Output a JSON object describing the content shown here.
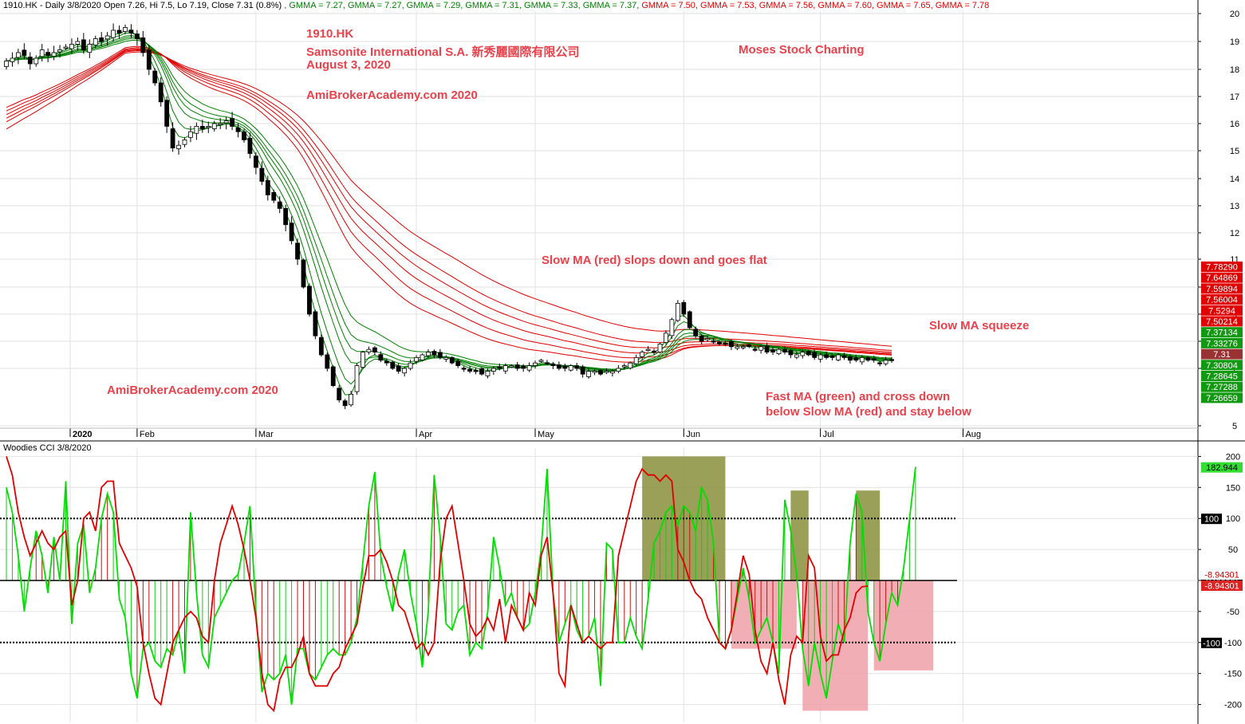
{
  "header": {
    "symbol_line": "1910.HK - Daily 3/8/2020 Open 7.26, Hi 7.5, Lo 7.19, Close 7.31 (0.8%)",
    "gmma": [
      {
        "text": "GMMA = 7.27",
        "color": "#008000"
      },
      {
        "text": "GMMA = 7.27",
        "color": "#008000"
      },
      {
        "text": "GMMA = 7.29",
        "color": "#008000"
      },
      {
        "text": "GMMA = 7.31",
        "color": "#008000"
      },
      {
        "text": "GMMA = 7.33",
        "color": "#008000"
      },
      {
        "text": "GMMA = 7.37",
        "color": "#008000"
      },
      {
        "text": "GMMA = 7.50",
        "color": "#e00000"
      },
      {
        "text": "GMMA = 7.53",
        "color": "#e00000"
      },
      {
        "text": "GMMA = 7.56",
        "color": "#e00000"
      },
      {
        "text": "GMMA = 7.60",
        "color": "#e00000"
      },
      {
        "text": "GMMA = 7.65",
        "color": "#e00000"
      },
      {
        "text": "GMMA = 7.78",
        "color": "#e00000"
      }
    ]
  },
  "annotations": {
    "ticker": "1910.HK",
    "company": "Samsonite International S.A. 新秀麗國際有限公司",
    "date": "August 3, 2020",
    "site_top": "AmiBrokerAcademy.com  2020",
    "moses": "Moses Stock Charting",
    "slow_ma": "Slow MA (red) slops down and goes flat",
    "squeeze": "Slow MA squeeze",
    "fast_ma_1": "Fast MA (green) and cross down",
    "fast_ma_2": "below Slow MA (red) and stay below",
    "site_bottom": "AmiBrokerAcademy.com   2020"
  },
  "indicator_label": "Woodies CCI  3/8/2020",
  "colors": {
    "up_candle": "#ffffff",
    "down_candle": "#000000",
    "fast_ma": "#008000",
    "slow_ma": "#e00000",
    "annotation": "#e8434c",
    "cci_line": "#00e000",
    "tcci_line": "#e00000",
    "green_box": "#8a8f3c",
    "pink_box": "#f0a0a8"
  },
  "chart_data": [
    {
      "type": "candlestick",
      "title": "1910.HK - Daily",
      "x_ticks": [
        "2020",
        "Feb",
        "Mar",
        "Apr",
        "May",
        "Jun",
        "Jul",
        "Aug"
      ],
      "x_tick_days": [
        0,
        22,
        42,
        69,
        89,
        114,
        137,
        161
      ],
      "y_ticks": [
        5,
        7,
        8,
        9,
        10,
        11,
        12,
        13,
        14,
        15,
        16,
        17,
        18,
        19,
        20
      ],
      "ylim": [
        4.6,
        20.4
      ],
      "close": [
        18.3,
        18.4,
        18.6,
        18.5,
        18.2,
        18.4,
        18.7,
        18.5,
        18.6,
        18.7,
        18.8,
        18.9,
        19.0,
        18.7,
        18.9,
        19.1,
        19.0,
        19.2,
        19.4,
        19.3,
        19.5,
        19.3,
        19.1,
        18.6,
        18.0,
        17.5,
        16.8,
        15.9,
        15.1,
        15.2,
        15.4,
        15.7,
        15.9,
        15.8,
        15.9,
        16.0,
        16.0,
        16.1,
        15.9,
        15.7,
        15.4,
        14.9,
        14.4,
        13.9,
        13.4,
        13.2,
        12.9,
        12.3,
        11.7,
        11.0,
        10.0,
        9.0,
        8.2,
        7.5,
        7.0,
        6.4,
        5.9,
        5.7,
        6.1,
        7.1,
        7.6,
        7.7,
        7.6,
        7.3,
        7.2,
        7.0,
        6.9,
        7.0,
        7.2,
        7.4,
        7.5,
        7.6,
        7.5,
        7.4,
        7.4,
        7.2,
        7.1,
        7.0,
        6.9,
        6.9,
        6.8,
        6.9,
        7.0,
        7.0,
        7.1,
        7.1,
        7.0,
        7.0,
        7.1,
        7.2,
        7.3,
        7.2,
        7.1,
        7.0,
        7.0,
        7.1,
        7.0,
        6.8,
        6.9,
        6.9,
        6.8,
        6.9,
        6.9,
        7.0,
        7.1,
        7.2,
        7.4,
        7.6,
        7.7,
        7.6,
        7.9,
        8.3,
        8.8,
        9.4,
        9.0,
        8.5,
        8.2,
        8.0,
        8.1,
        8.0,
        7.9,
        7.9,
        7.8,
        7.8,
        7.8,
        7.8,
        7.7,
        7.8,
        7.6,
        7.6,
        7.7,
        7.6,
        7.5,
        7.5,
        7.6,
        7.5,
        7.4,
        7.5,
        7.4,
        7.4,
        7.5,
        7.4,
        7.3,
        7.3,
        7.4,
        7.3,
        7.3,
        7.2,
        7.3,
        7.31
      ],
      "volatility": 0.35,
      "gmma_fast": [
        3,
        5,
        8,
        10,
        12,
        15
      ],
      "gmma_slow": [
        30,
        35,
        40,
        45,
        50,
        60
      ],
      "price_labels_right": [
        {
          "text": "7.78290",
          "value": 7.78,
          "color": "#e00000"
        },
        {
          "text": "7.64869",
          "value": 7.65,
          "color": "#e00000"
        },
        {
          "text": "7.59894",
          "value": 7.6,
          "color": "#e00000"
        },
        {
          "text": "7.56004",
          "value": 7.56,
          "color": "#e00000"
        },
        {
          "text": "7.5294",
          "value": 7.53,
          "color": "#e00000"
        },
        {
          "text": "7.50214",
          "value": 7.5,
          "color": "#e00000"
        },
        {
          "text": "7.37134",
          "value": 7.37,
          "color": "#119911"
        },
        {
          "text": "7.33276",
          "value": 7.33,
          "color": "#119911"
        },
        {
          "text": "7.31",
          "value": 7.31,
          "color": "#993333"
        },
        {
          "text": "7.30804",
          "value": 7.31,
          "color": "#119911"
        },
        {
          "text": "7.28645",
          "value": 7.29,
          "color": "#119911"
        },
        {
          "text": "7.27288",
          "value": 7.27,
          "color": "#119911"
        },
        {
          "text": "7.26659",
          "value": 7.27,
          "color": "#119911"
        }
      ]
    },
    {
      "type": "line",
      "title": "Woodies CCI  3/8/2020",
      "y_ticks": [
        -200,
        -150,
        -100,
        -50,
        0,
        50,
        100,
        150,
        200
      ],
      "ylim": [
        -225,
        215
      ],
      "reference_lines": [
        -100,
        0,
        100
      ],
      "series": [
        {
          "name": "CCI",
          "values": [
            150,
            110,
            40,
            -50,
            20,
            80,
            40,
            -20,
            70,
            0,
            160,
            -70,
            60,
            90,
            -20,
            20,
            100,
            140,
            110,
            -30,
            -60,
            -150,
            -190,
            -110,
            -100,
            -130,
            -140,
            -110,
            -120,
            -80,
            -150,
            110,
            -20,
            -120,
            -140,
            -60,
            -40,
            -20,
            0,
            10,
            60,
            120,
            -50,
            -180,
            -150,
            -160,
            -150,
            -120,
            -200,
            -110,
            -110,
            -150,
            -160,
            -140,
            -120,
            -110,
            -120,
            -120,
            -100,
            -60,
            30,
            120,
            175,
            40,
            -10,
            -50,
            10,
            50,
            -20,
            -70,
            -140,
            -50,
            170,
            70,
            -70,
            -80,
            -50,
            -40,
            -120,
            -100,
            -110,
            -50,
            70,
            20,
            -40,
            -20,
            -60,
            -80,
            -70,
            -20,
            50,
            180,
            -20,
            -100,
            -70,
            -40,
            -80,
            -100,
            -90,
            -60,
            -170,
            60,
            50,
            -100,
            -100,
            -60,
            -90,
            -110,
            -30,
            60,
            80,
            110,
            120,
            90,
            120,
            110,
            80,
            150,
            130,
            60,
            -100,
            -110,
            -80,
            -30,
            20,
            -30,
            -100,
            -80,
            -60,
            -100,
            -150,
            130,
            80,
            10,
            -110,
            -170,
            -100,
            -150,
            -190,
            -130,
            -70,
            -100,
            60,
            140,
            110,
            -50,
            -100,
            -130,
            -70,
            -20,
            -40,
            20,
            100,
            183
          ]
        },
        {
          "name": "TCCI",
          "values": [
            200,
            170,
            110,
            70,
            40,
            60,
            80,
            60,
            50,
            70,
            80,
            -40,
            0,
            100,
            110,
            80,
            150,
            160,
            160,
            60,
            40,
            20,
            -10,
            -100,
            -150,
            -190,
            -200,
            -150,
            -100,
            -80,
            -60,
            -50,
            -60,
            -90,
            -100,
            0,
            60,
            90,
            120,
            90,
            50,
            0,
            -60,
            -150,
            -200,
            -210,
            -160,
            -140,
            -140,
            -120,
            -90,
            -150,
            -170,
            -170,
            -170,
            -150,
            -140,
            -110,
            -90,
            -70,
            -10,
            40,
            40,
            50,
            30,
            0,
            -40,
            -50,
            -80,
            -110,
            -100,
            -120,
            -100,
            30,
            100,
            120,
            60,
            0,
            -70,
            -90,
            -80,
            -60,
            -80,
            -30,
            -100,
            -40,
            -60,
            -80,
            -20,
            -40,
            40,
            70,
            -20,
            -150,
            -170,
            -40,
            -70,
            -100,
            -90,
            -100,
            -110,
            -100,
            -100,
            40,
            80,
            120,
            160,
            180,
            170,
            170,
            160,
            170,
            160,
            50,
            30,
            0,
            -20,
            -30,
            -60,
            -80,
            -100,
            -110,
            -80,
            -20,
            40,
            10,
            -80,
            -130,
            -150,
            -100,
            -160,
            -200,
            -120,
            -90,
            -100,
            40,
            20,
            -90,
            -130,
            -120,
            -120,
            -80,
            -60,
            -20,
            -10,
            -8.94
          ]
        }
      ],
      "highlight_boxes": [
        {
          "from": 107,
          "to": 121,
          "y1": 0,
          "y2": 200,
          "color": "#8a8f3c"
        },
        {
          "from": 122,
          "to": 133,
          "y1": -110,
          "y2": 0,
          "color": "#f0a0a8"
        },
        {
          "from": 132,
          "to": 135,
          "y1": 0,
          "y2": 145,
          "color": "#8a8f3c"
        },
        {
          "from": 134,
          "to": 145,
          "y1": -210,
          "y2": 0,
          "color": "#f0a0a8"
        },
        {
          "from": 143,
          "to": 147,
          "y1": 0,
          "y2": 145,
          "color": "#8a8f3c"
        },
        {
          "from": 146,
          "to": 156,
          "y1": -145,
          "y2": 0,
          "color": "#f0a0a8"
        }
      ],
      "value_labels_right": [
        {
          "text": "182.944",
          "value": 182.944,
          "bg": "#33dd33",
          "fg": "#000000"
        },
        {
          "text": "100",
          "value": 100,
          "bg": "#000000",
          "fg": "#ffffff"
        },
        {
          "text": "0.00000",
          "value": 0,
          "bg": "#000000",
          "fg": "#ffffff"
        },
        {
          "text": "-8.94301",
          "value": -8.94301,
          "bg": "#ffffff",
          "fg": "#cc0000"
        },
        {
          "text": "-8.94301",
          "value": -8.94301,
          "bg": "#dd2222",
          "fg": "#ffffff"
        },
        {
          "text": "-100",
          "value": -100,
          "bg": "#000000",
          "fg": "#ffffff"
        }
      ]
    }
  ]
}
